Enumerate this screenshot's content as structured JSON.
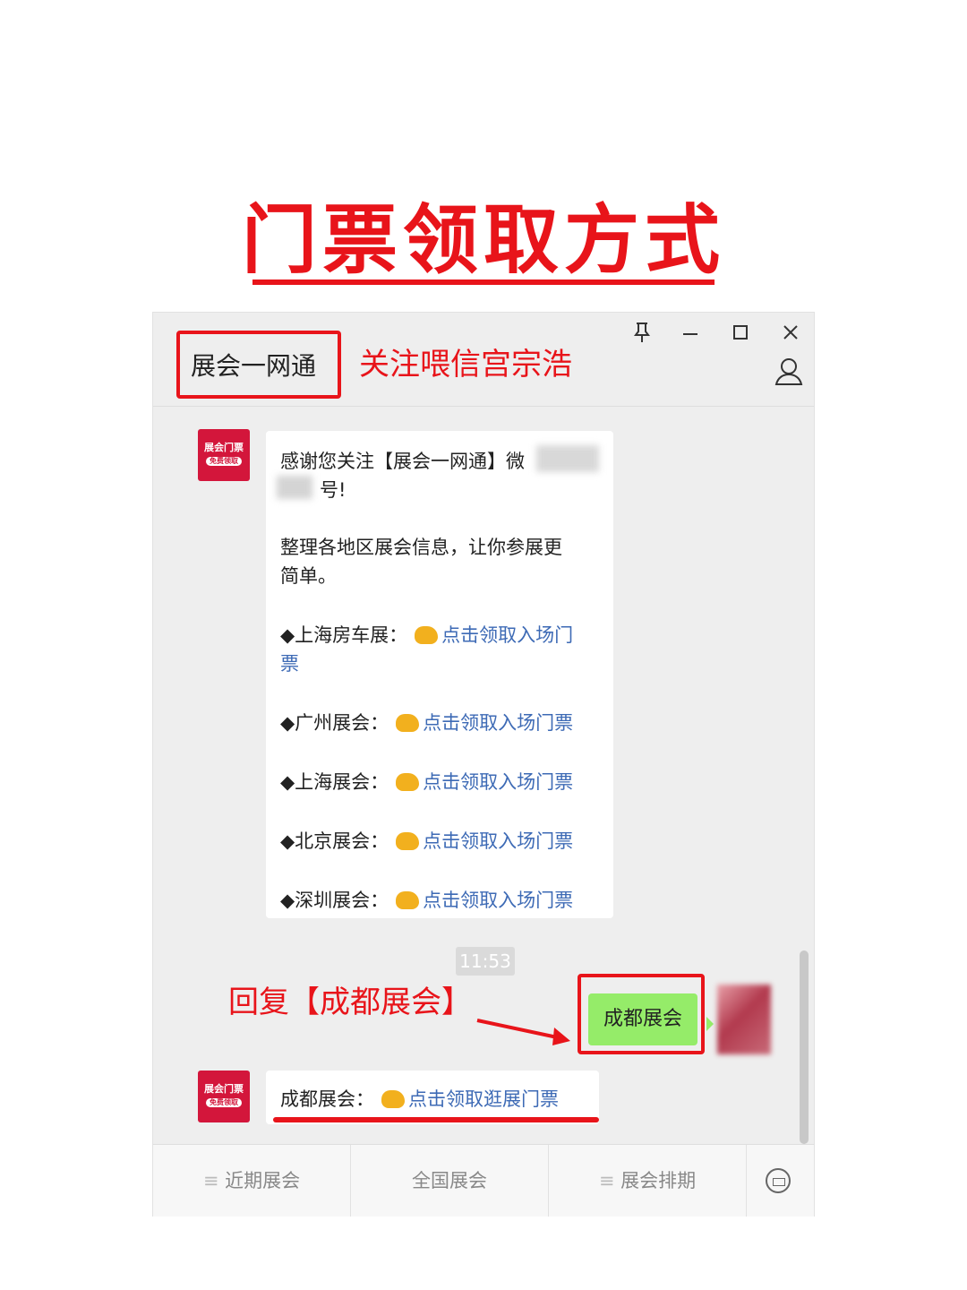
{
  "headline": "门票领取方式",
  "window": {
    "account_name": "展会一网通",
    "annotation_follow": "关注喂信宫宗浩",
    "controls": {
      "pin": "pin-icon",
      "minimize": "minimize-icon",
      "maximize": "maximize-icon",
      "close": "close-icon"
    }
  },
  "chat": {
    "avatar_text": "展会门票",
    "avatar_sub": "免费领取",
    "welcome": {
      "line1": "感谢您关注【展会一网通】微",
      "line2": "号!",
      "line3": "整理各地区展会信息，让你参展更",
      "line4": "简单。",
      "items": [
        {
          "label": "◆上海房车展：",
          "link": "点击领取入场门",
          "link_cont": "票"
        },
        {
          "label": "◆广州展会：",
          "link": "点击领取入场门票"
        },
        {
          "label": "◆上海展会：",
          "link": "点击领取入场门票"
        },
        {
          "label": "◆北京展会：",
          "link": "点击领取入场门票"
        },
        {
          "label": "◆深圳展会：",
          "link": "点击领取入场门票"
        }
      ]
    },
    "timestamp": "11:53",
    "annotation_reply": "回复【成都展会】",
    "user_message": "成都展会",
    "reply": {
      "label": "成都展会：",
      "link": "点击领取逛展门票"
    }
  },
  "menu": {
    "items": [
      "近期展会",
      "全国展会",
      "展会排期"
    ],
    "keyboard_icon": "keyboard-icon"
  },
  "colors": {
    "annotation_red": "#e8141a",
    "link_blue": "#3d6ab5",
    "bubble_green": "#95ec69"
  }
}
